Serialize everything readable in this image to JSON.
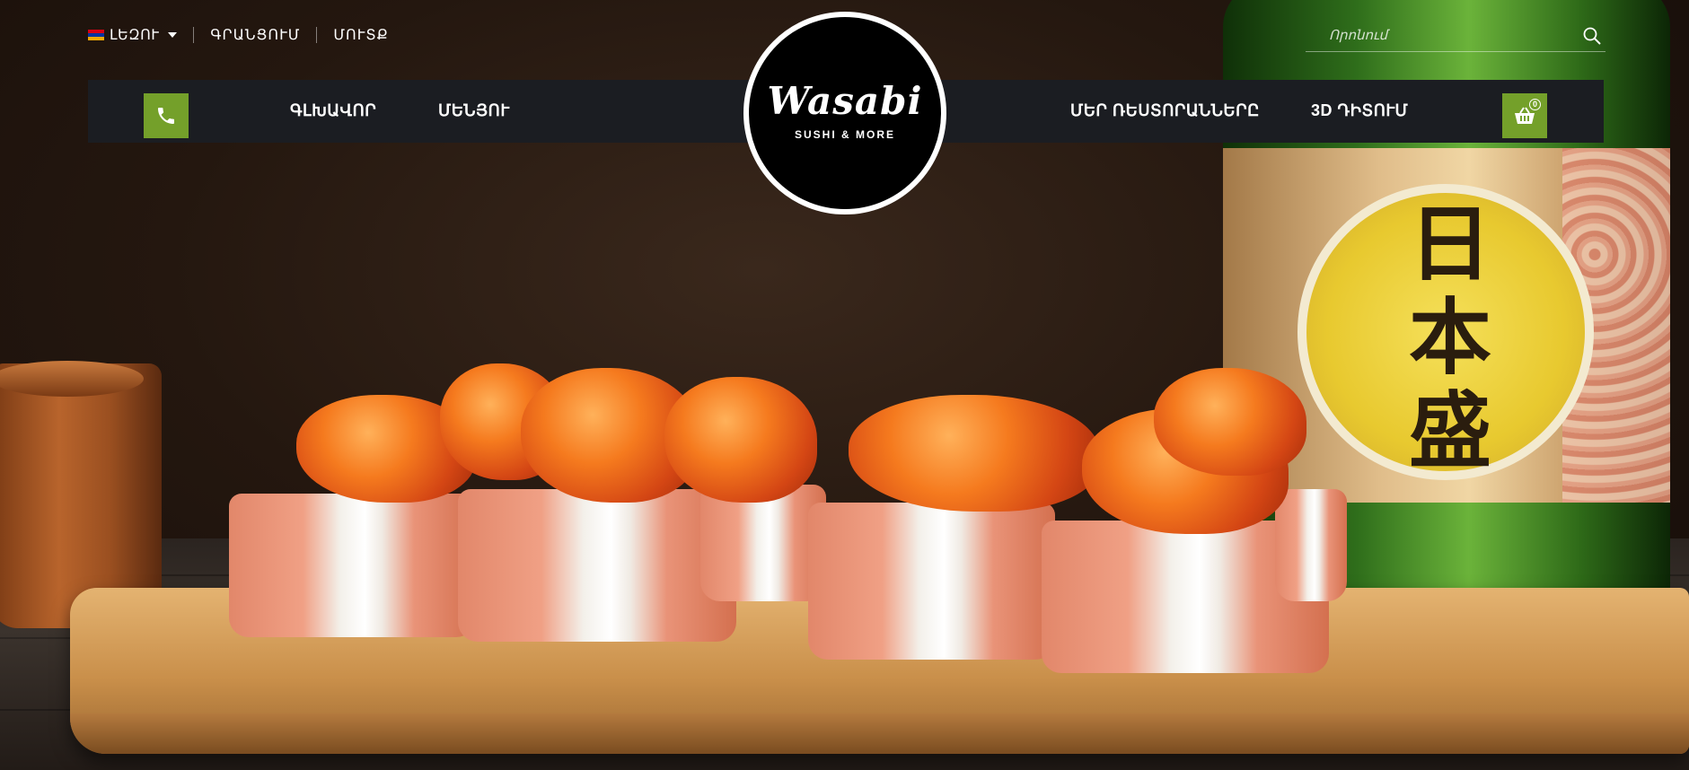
{
  "topbar": {
    "language_label": "ԼԵԶՈՒ",
    "register_link": "ԳՐԱՆՑՈՒՄ",
    "login_link": "ՄՈՒՏՔ"
  },
  "search": {
    "placeholder": "Որոնում"
  },
  "logo": {
    "word": "Wasabi",
    "tagline": "SUSHI & MORE"
  },
  "nav": {
    "home": "ԳԼԽԱՎՈՐ",
    "menu": "ՄԵՆՅՈՒ",
    "restaurants": "ՄԵՐ ՌԵՍՏՈՐԱՆՆԵՐԸ",
    "view3d": "3D ԴԻՏՈՒՄ"
  },
  "cart": {
    "count": "0"
  },
  "hero": {
    "bottle_kanji": "日本盛"
  },
  "colors": {
    "accent_green": "#74a02a",
    "nav_bg": "#1b1d22"
  },
  "icons": [
    "flag-armenia-icon",
    "chevron-down-icon",
    "search-icon",
    "phone-icon",
    "basket-icon"
  ]
}
